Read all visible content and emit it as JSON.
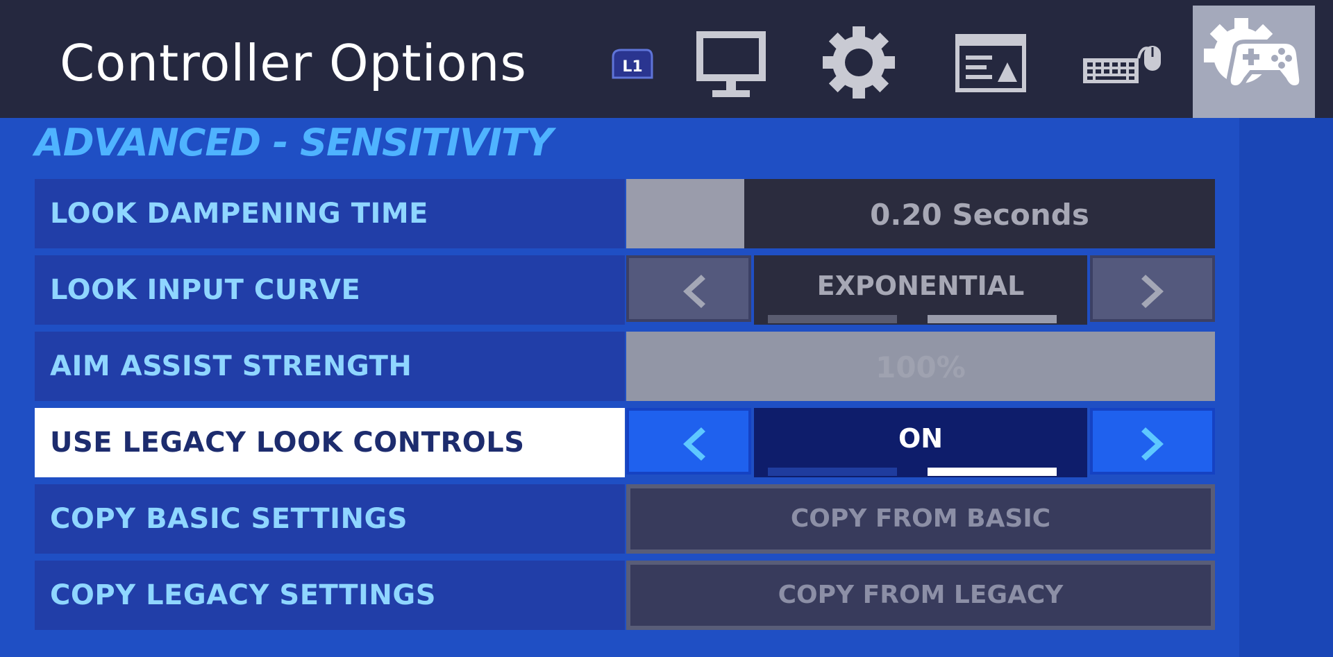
{
  "header": {
    "title": "Controller Options",
    "bumper_left_label": "L1",
    "tabs": [
      {
        "icon": "monitor-icon"
      },
      {
        "icon": "gear-icon"
      },
      {
        "icon": "hud-layout-icon"
      },
      {
        "icon": "keyboard-mouse-icon"
      },
      {
        "icon": "gamepad-gear-icon",
        "active": true
      }
    ]
  },
  "section": {
    "heading": "ADVANCED - SENSITIVITY"
  },
  "settings": [
    {
      "label": "LOOK DAMPENING TIME",
      "control": "slider",
      "value": "0.20 Seconds",
      "fill_fraction": 0.165
    },
    {
      "label": "LOOK INPUT CURVE",
      "control": "selector",
      "value": "EXPONENTIAL",
      "option_index": 1,
      "option_count": 2
    },
    {
      "label": "AIM ASSIST STRENGTH",
      "control": "slider",
      "value": "100%",
      "disabled": true
    },
    {
      "label": "USE LEGACY LOOK CONTROLS",
      "control": "selector",
      "value": "ON",
      "option_index": 1,
      "option_count": 2,
      "selected": true
    },
    {
      "label": "COPY BASIC SETTINGS",
      "control": "button",
      "value": "COPY FROM BASIC"
    },
    {
      "label": "COPY LEGACY SETTINGS",
      "control": "button",
      "value": "COPY FROM LEGACY"
    }
  ],
  "colors": {
    "header_bg": "#25283f",
    "page_bg": "#1f4fc4",
    "label_text": "#8fd6ff",
    "heading_text": "#4fb3ff",
    "selected_row_bg": "#ffffff",
    "active_tab_bg": "#a4a9bb"
  }
}
